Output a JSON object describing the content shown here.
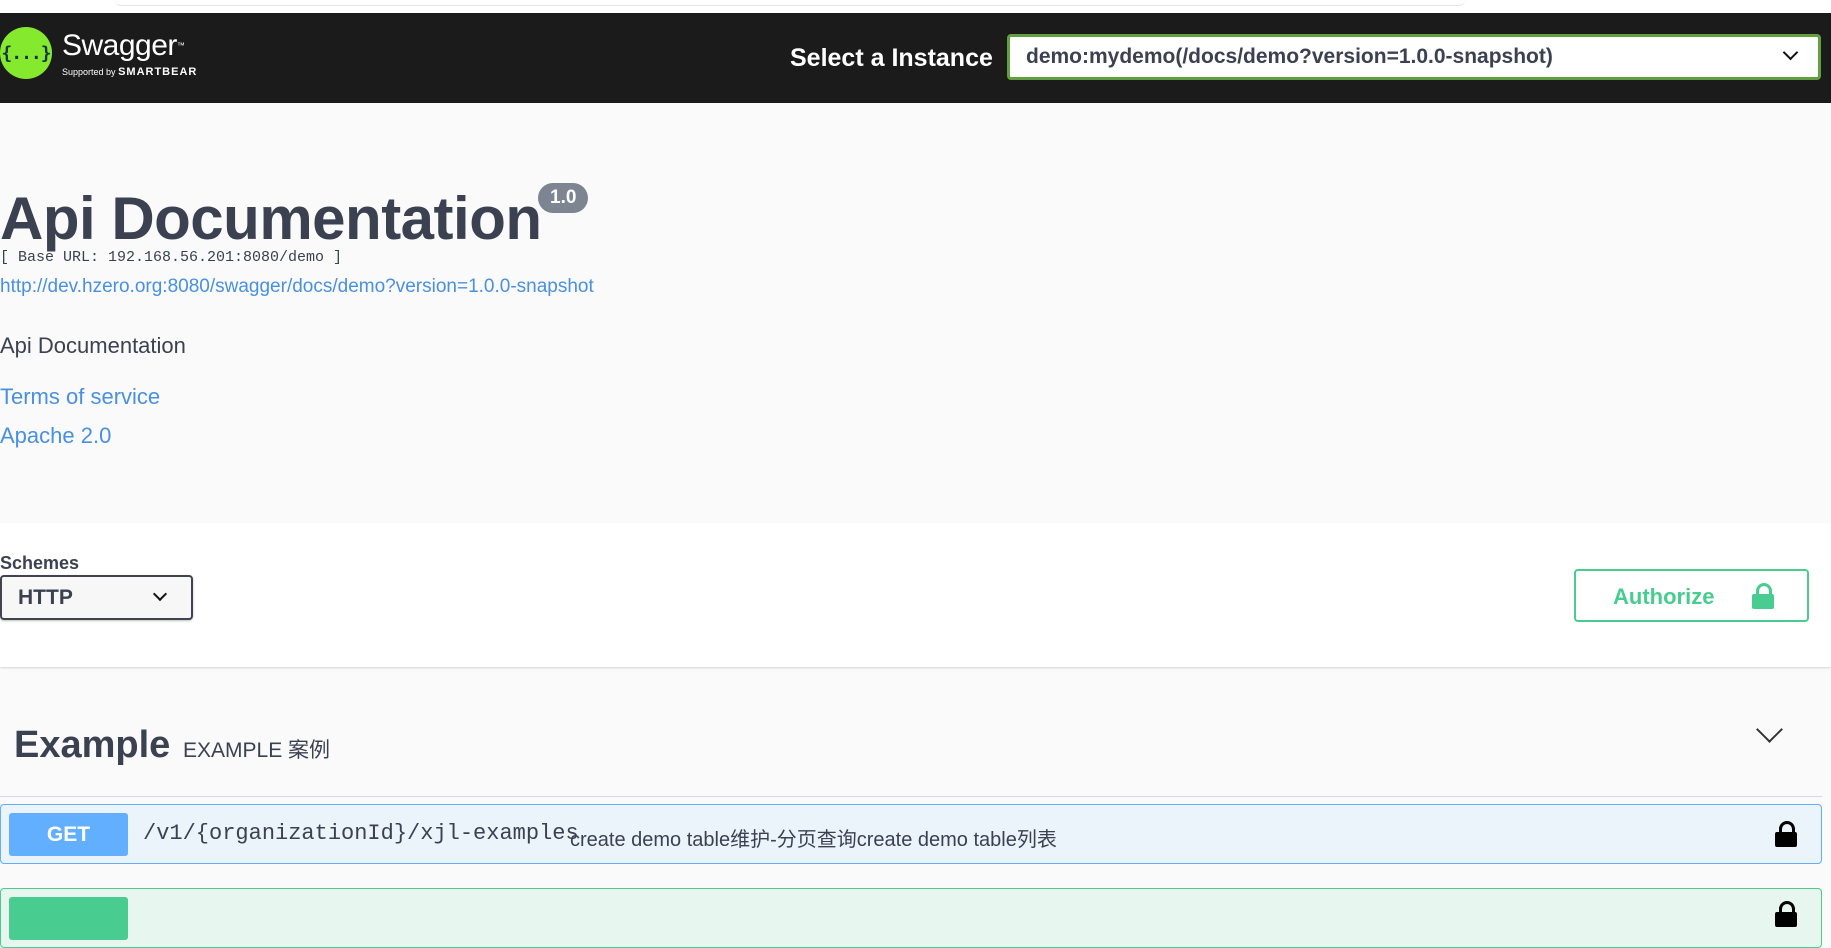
{
  "topbar": {
    "logo": {
      "name": "Swagger",
      "tm": "™",
      "supported_by": "Supported by",
      "brand": "SMARTBEAR",
      "mark": "{...}"
    },
    "instance_label": "Select a Instance",
    "instance_value": "demo:mydemo(/docs/demo?version=1.0.0-snapshot)"
  },
  "info": {
    "title": "Api Documentation",
    "version": "1.0",
    "base_url": "[ Base URL: 192.168.56.201:8080/demo ]",
    "spec_url": "http://dev.hzero.org:8080/swagger/docs/demo?version=1.0.0-snapshot",
    "description": "Api Documentation",
    "terms_label": "Terms of service",
    "license_label": "Apache 2.0"
  },
  "schemes": {
    "label": "Schemes",
    "selected": "HTTP",
    "authorize_label": "Authorize"
  },
  "tags": [
    {
      "name": "Example",
      "description": "EXAMPLE 案例",
      "operations": [
        {
          "method": "GET",
          "path": "/v1/{organizationId}/xjl-examples",
          "summary": "create demo table维护-分页查询create demo table列表"
        }
      ]
    }
  ],
  "colors": {
    "topbar_bg": "#1b1b1b",
    "accent_green": "#49cc90",
    "get_blue": "#61affe",
    "link_blue": "#4990e2",
    "instance_border": "#62a03f"
  }
}
